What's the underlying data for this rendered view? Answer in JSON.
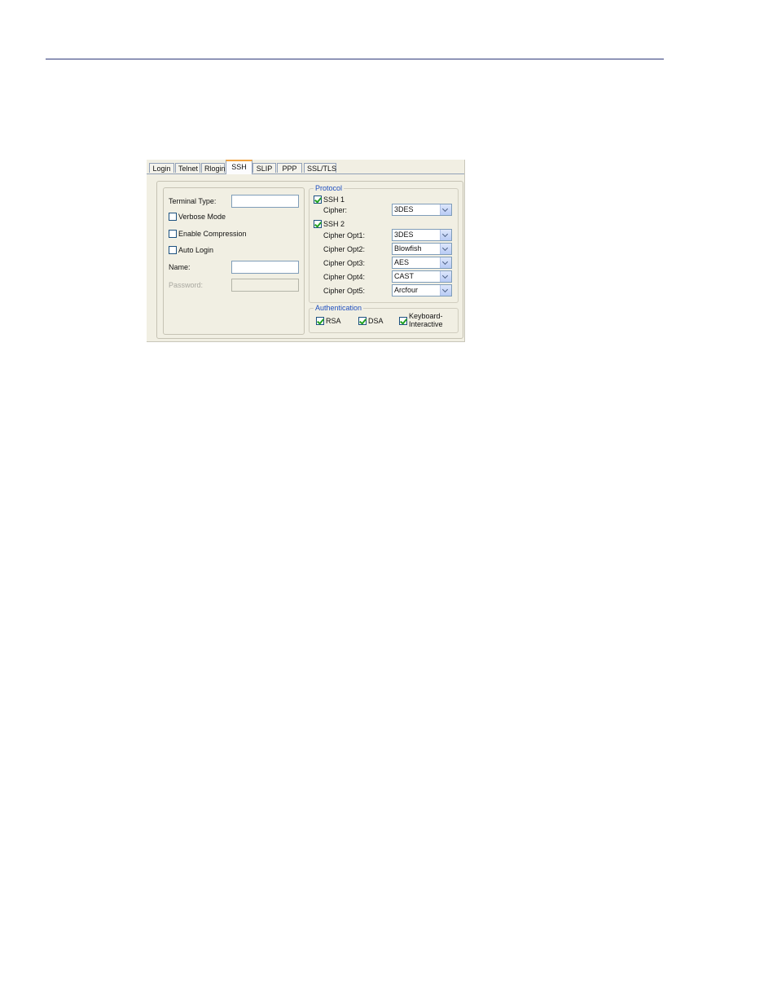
{
  "tabs": [
    {
      "label": "Login",
      "active": false
    },
    {
      "label": "Telnet",
      "active": false
    },
    {
      "label": "Rlogin",
      "active": false
    },
    {
      "label": "SSH",
      "active": true
    },
    {
      "label": "SLIP",
      "active": false
    },
    {
      "label": "PPP",
      "active": false
    },
    {
      "label": "SSL/TLS",
      "active": false
    }
  ],
  "left_panel": {
    "terminal_type_label": "Terminal Type:",
    "terminal_type_value": "",
    "verbose_mode_label": "Verbose Mode",
    "verbose_mode_checked": false,
    "enable_compression_label": "Enable Compression",
    "enable_compression_checked": false,
    "auto_login_label": "Auto Login",
    "auto_login_checked": false,
    "name_label": "Name:",
    "name_value": "",
    "password_label": "Password:",
    "password_value": ""
  },
  "protocol": {
    "legend": "Protocol",
    "ssh1_label": "SSH 1",
    "ssh1_checked": true,
    "cipher_label": "Cipher:",
    "cipher_value": "3DES",
    "ssh2_label": "SSH 2",
    "ssh2_checked": true,
    "cipher_opts": [
      {
        "label": "Cipher Opt1:",
        "value": "3DES"
      },
      {
        "label": "Cipher Opt2:",
        "value": "Blowfish"
      },
      {
        "label": "Cipher Opt3:",
        "value": "AES"
      },
      {
        "label": "Cipher Opt4:",
        "value": "CAST"
      },
      {
        "label": "Cipher Opt5:",
        "value": "Arcfour"
      }
    ]
  },
  "authentication": {
    "legend": "Authentication",
    "rsa_label": "RSA",
    "rsa_checked": true,
    "dsa_label": "DSA",
    "dsa_checked": true,
    "kbd_label_line1": "Keyboard-",
    "kbd_label_line2": "Interactive",
    "kbd_checked": true
  },
  "colors": {
    "accent_tab": "#f0a340",
    "legend_text": "#1f4fbf",
    "check_mark": "#21a121",
    "panel_bg": "#f1efe3"
  }
}
